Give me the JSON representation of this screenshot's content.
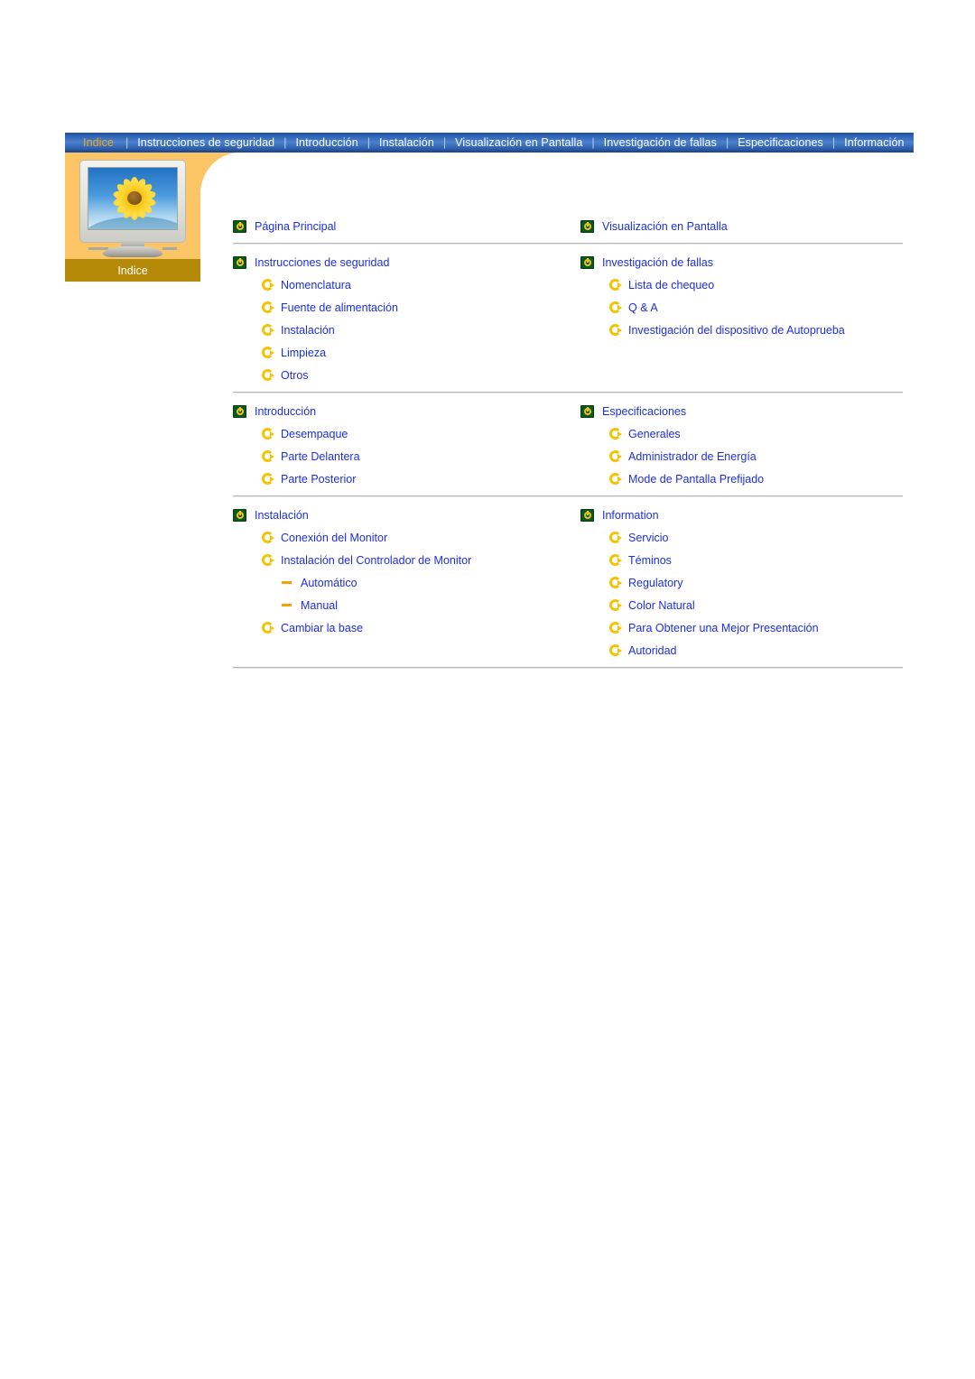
{
  "nav": {
    "tabs": [
      {
        "label": "Indice",
        "active": true
      },
      {
        "label": "Instrucciones de seguridad",
        "active": false
      },
      {
        "label": "Introducción",
        "active": false
      },
      {
        "label": "Instalación",
        "active": false
      },
      {
        "label": "Visualización en Pantalla",
        "active": false
      },
      {
        "label": "Investigación de fallas",
        "active": false
      },
      {
        "label": "Especificaciones",
        "active": false
      },
      {
        "label": "Información",
        "active": false
      }
    ],
    "separator": "|"
  },
  "sidebar": {
    "label": "Indice",
    "image": "monitor-with-sunflower-image",
    "accent_color": "#fcc566",
    "label_band_color": "#b48a08"
  },
  "colors": {
    "link": "#1c2ee8",
    "nav_active": "#f5a714",
    "nav_background": "#2f63b6",
    "icon_green": "#0a5a1e",
    "icon_yellow": "#f5c400",
    "dash_orange": "#f5a100",
    "divider": "#b6b6b6"
  },
  "content": {
    "groups": [
      {
        "left": {
          "items": [
            {
              "level": 1,
              "label": "Página Principal",
              "icon": "green-power-icon"
            }
          ]
        },
        "right": {
          "items": [
            {
              "level": 1,
              "label": "Visualización en Pantalla",
              "icon": "green-power-icon"
            }
          ]
        }
      },
      {
        "left": {
          "items": [
            {
              "level": 1,
              "label": "Instrucciones de seguridad",
              "icon": "green-power-icon"
            },
            {
              "level": 2,
              "label": "Nomenclatura",
              "icon": "yellow-arrow-icon"
            },
            {
              "level": 2,
              "label": "Fuente de alimentación",
              "icon": "yellow-arrow-icon"
            },
            {
              "level": 2,
              "label": "Instalación",
              "icon": "yellow-arrow-icon"
            },
            {
              "level": 2,
              "label": "Limpieza",
              "icon": "yellow-arrow-icon"
            },
            {
              "level": 2,
              "label": "Otros",
              "icon": "yellow-arrow-icon"
            }
          ]
        },
        "right": {
          "items": [
            {
              "level": 1,
              "label": "Investigación de fallas",
              "icon": "green-power-icon"
            },
            {
              "level": 2,
              "label": "Lista de chequeo",
              "icon": "yellow-arrow-icon"
            },
            {
              "level": 2,
              "label": "Q & A",
              "icon": "yellow-arrow-icon"
            },
            {
              "level": 2,
              "label": "Investigación del dispositivo de Autoprueba",
              "icon": "yellow-arrow-icon"
            }
          ]
        }
      },
      {
        "left": {
          "items": [
            {
              "level": 1,
              "label": "Introducción",
              "icon": "green-power-icon"
            },
            {
              "level": 2,
              "label": "Desempaque",
              "icon": "yellow-arrow-icon"
            },
            {
              "level": 2,
              "label": "Parte Delantera",
              "icon": "yellow-arrow-icon"
            },
            {
              "level": 2,
              "label": "Parte Posterior",
              "icon": "yellow-arrow-icon"
            }
          ]
        },
        "right": {
          "items": [
            {
              "level": 1,
              "label": "Especificaciones",
              "icon": "green-power-icon"
            },
            {
              "level": 2,
              "label": "Generales",
              "icon": "yellow-arrow-icon"
            },
            {
              "level": 2,
              "label": "Administrador de Energía",
              "icon": "yellow-arrow-icon"
            },
            {
              "level": 2,
              "label": "Mode de Pantalla Prefijado",
              "icon": "yellow-arrow-icon"
            }
          ]
        }
      },
      {
        "left": {
          "items": [
            {
              "level": 1,
              "label": "Instalación",
              "icon": "green-power-icon"
            },
            {
              "level": 2,
              "label": "Conexión del Monitor",
              "icon": "yellow-arrow-icon"
            },
            {
              "level": 2,
              "label": "Instalación del Controlador de Monitor",
              "icon": "yellow-arrow-icon"
            },
            {
              "level": 3,
              "label": "Automático",
              "icon": "orange-dash-icon"
            },
            {
              "level": 3,
              "label": "Manual",
              "icon": "orange-dash-icon"
            },
            {
              "level": 2,
              "label": "Cambiar la base",
              "icon": "yellow-arrow-icon"
            }
          ]
        },
        "right": {
          "items": [
            {
              "level": 1,
              "label": "Information",
              "icon": "green-power-icon"
            },
            {
              "level": 2,
              "label": "Servicio",
              "icon": "yellow-arrow-icon"
            },
            {
              "level": 2,
              "label": "Téminos",
              "icon": "yellow-arrow-icon"
            },
            {
              "level": 2,
              "label": "Regulatory",
              "icon": "yellow-arrow-icon"
            },
            {
              "level": 2,
              "label": "Color Natural",
              "icon": "yellow-arrow-icon"
            },
            {
              "level": 2,
              "label": "Para Obtener una Mejor Presentación",
              "icon": "yellow-arrow-icon"
            },
            {
              "level": 2,
              "label": "Autoridad",
              "icon": "yellow-arrow-icon"
            }
          ]
        }
      }
    ]
  }
}
